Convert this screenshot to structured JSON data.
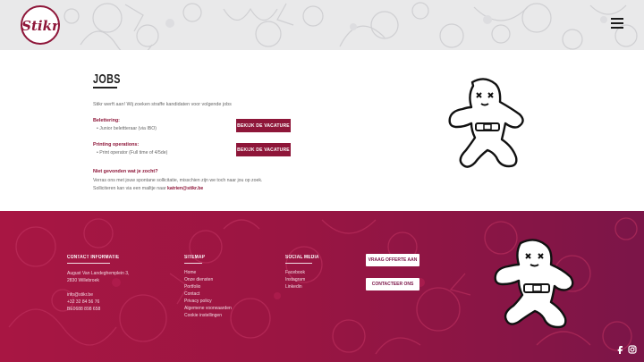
{
  "header": {
    "logo_text": "Stikr",
    "menu_icon": "hamburger-menu-icon"
  },
  "jobs": {
    "title": "JOBS",
    "intro": "Stikr werft aan! Wij zoeken straffe kandidaten voor volgende jobs",
    "categories": [
      {
        "label": "Belettering:",
        "item": "Junior belettteraar (via IBO)",
        "button": "BEKIJK DE VACATURE"
      },
      {
        "label": "Printing operations:",
        "item": "Print operator (Full time of 4/5de)",
        "button": "BEKIJK DE VACATURE"
      }
    ],
    "not_found_title": "Niet gevonden wat je zocht?",
    "not_found_line1": "Verras ons met jouw spontane sollicitatie, misschien zijn we toch naar jou op zoek.",
    "not_found_line2_prefix": "Solliciteren kan via een mailtje naar ",
    "not_found_email": "katrien@stikr.be"
  },
  "footer": {
    "contact": {
      "heading": "CONTACT INFORMATIE",
      "address1": "August Van Landeghemplein 3,",
      "address2": "2830 Willebroek",
      "email": "info@stikr.be",
      "phone": "+32 32 84 56 76",
      "vat": "BE0688 898 658"
    },
    "sitemap": {
      "heading": "SITEMAP",
      "links": [
        "Home",
        "Onze diensten",
        "Portfolio",
        "Contact",
        "Privacy policy",
        "Algemene voorwaarden",
        "Cookie instellingen"
      ]
    },
    "social": {
      "heading": "SOCIAL MEDIA",
      "links": [
        "Facebook",
        "Instagram",
        "Linkedin"
      ]
    },
    "buttons": {
      "quote": "VRAAG OFFERTE AAN",
      "contact": "CONTACTEER ONS"
    },
    "social_icons": [
      "facebook-icon",
      "instagram-icon"
    ]
  },
  "colors": {
    "brand": "#8e1639",
    "footer_start": "#a81643",
    "footer_end": "#7b1548"
  }
}
